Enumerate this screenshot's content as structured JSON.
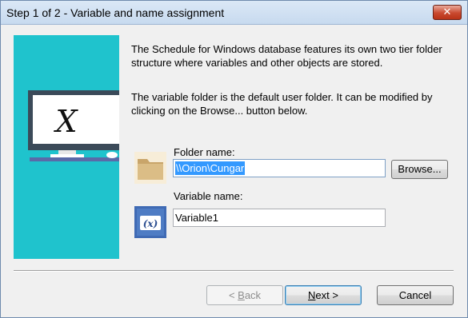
{
  "window": {
    "title": "Step 1 of 2 - Variable and name assignment",
    "close_label": "✕"
  },
  "illustration": {
    "screen_letter": "X",
    "background_color": "#1fc3cd"
  },
  "description": {
    "paragraph1": "The Schedule for Windows database features its own two tier folder structure where variables and other objects are stored.",
    "paragraph2": "The variable folder is the default user folder. It can be modified by clicking on the Browse... button below."
  },
  "folder": {
    "label": "Folder name:",
    "value": "\\\\Orion\\Cungar",
    "icon": "folder-icon",
    "browse_label": "Browse..."
  },
  "variable": {
    "label": "Variable name:",
    "value": "Variable1",
    "icon": "variable-x-icon",
    "icon_text": "(x)"
  },
  "buttons": {
    "back": {
      "prefix": "< ",
      "accel": "B",
      "rest": "ack"
    },
    "next": {
      "accel": "N",
      "rest": "ext >"
    },
    "cancel": "Cancel"
  }
}
